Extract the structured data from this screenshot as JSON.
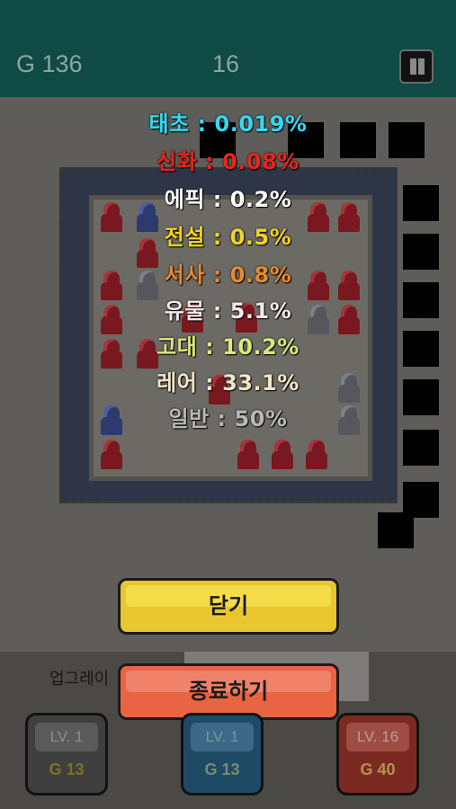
{
  "hud": {
    "gold": "G 136",
    "wave": "16",
    "pause_icon": "pause-icon"
  },
  "drop_rates": [
    {
      "label": "태초 : 0.019%",
      "color": "#33d9f2"
    },
    {
      "label": "신화 : 0.08%",
      "color": "#e8251b"
    },
    {
      "label": "에픽 : 0.2%",
      "color": "#ffffff"
    },
    {
      "label": "전설 : 0.5%",
      "color": "#f2d320"
    },
    {
      "label": "서사 : 0.8%",
      "color": "#e98a2e"
    },
    {
      "label": "유물 : 5.1%",
      "color": "#f2e7ea"
    },
    {
      "label": "고대 : 10.2%",
      "color": "#d8e87a"
    },
    {
      "label": "레어 : 33.1%",
      "color": "#f3e6c8"
    },
    {
      "label": "일반 : 50%",
      "color": "#b8b8b8"
    }
  ],
  "dialog": {
    "close_label": "닫기",
    "quit_label": "종료하기"
  },
  "upgrade": {
    "label": "업그레이"
  },
  "cards": [
    {
      "level": "LV. 1",
      "cost": "G 13"
    },
    {
      "level": "LV. 1",
      "cost": "G 13"
    },
    {
      "level": "LV. 16",
      "cost": "G 40"
    }
  ]
}
